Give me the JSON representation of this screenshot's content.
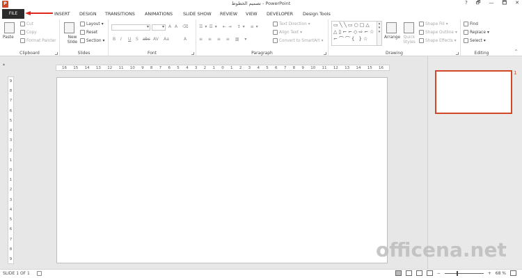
{
  "titlebar": {
    "app_icon_label": "P",
    "title": "تصميم الخطوط - PowerPoint",
    "controls": [
      "?",
      "🗗",
      "—",
      "🗖",
      "✕"
    ]
  },
  "tabs": {
    "file": "FILE",
    "items": [
      "INSERT",
      "DESIGN",
      "TRANSITIONS",
      "ANIMATIONS",
      "SLIDE SHOW",
      "REVIEW",
      "VIEW",
      "DEVELOPER",
      "Design Tools"
    ]
  },
  "clipboard": {
    "label": "Clipboard",
    "paste": "Paste",
    "cut": "Cut",
    "copy": "Copy",
    "format_painter": "Format Painter"
  },
  "slides": {
    "label": "Slides",
    "new_slide": "New Slide",
    "layout": "Layout",
    "reset": "Reset",
    "section": "Section"
  },
  "font": {
    "label": "Font",
    "buttons": [
      "B",
      "I",
      "U",
      "S",
      "abc",
      "AV",
      "Aa",
      "A"
    ]
  },
  "paragraph": {
    "label": "Paragraph",
    "text_direction": "Text Direction",
    "align_text": "Align Text",
    "convert_smartart": "Convert to SmartArt"
  },
  "drawing": {
    "label": "Drawing",
    "arrange": "Arrange",
    "quick_styles": "Quick Styles",
    "shape_fill": "Shape Fill",
    "shape_outline": "Shape Outline",
    "shape_effects": "Shape Effects",
    "shapes_row1": "▭╲╲▭○□△",
    "shapes_row2": "△▯⌐⌐◇⇨⌐☆",
    "shapes_row3": "⌐⌒⌒{ }☆"
  },
  "editing": {
    "label": "Editing",
    "find": "Find",
    "replace": "Replace",
    "select": "Select"
  },
  "ruler": {
    "h_ticks": [
      "16",
      "15",
      "14",
      "13",
      "12",
      "11",
      "10",
      "9",
      "8",
      "7",
      "6",
      "5",
      "4",
      "3",
      "2",
      "1",
      "0",
      "1",
      "2",
      "3",
      "4",
      "5",
      "6",
      "7",
      "8",
      "9",
      "10",
      "11",
      "12",
      "13",
      "14",
      "15",
      "16"
    ],
    "v_ticks": [
      "9",
      "8",
      "7",
      "6",
      "5",
      "4",
      "3",
      "2",
      "1",
      "0",
      "1",
      "2",
      "3",
      "4",
      "5",
      "6",
      "7",
      "8",
      "9"
    ]
  },
  "thumbnail": {
    "number": "1"
  },
  "watermark": "officena.net",
  "status": {
    "slide_info": "SLIDE 1 OF 1",
    "zoom": "68 %",
    "zoom_level_percent": 68
  }
}
